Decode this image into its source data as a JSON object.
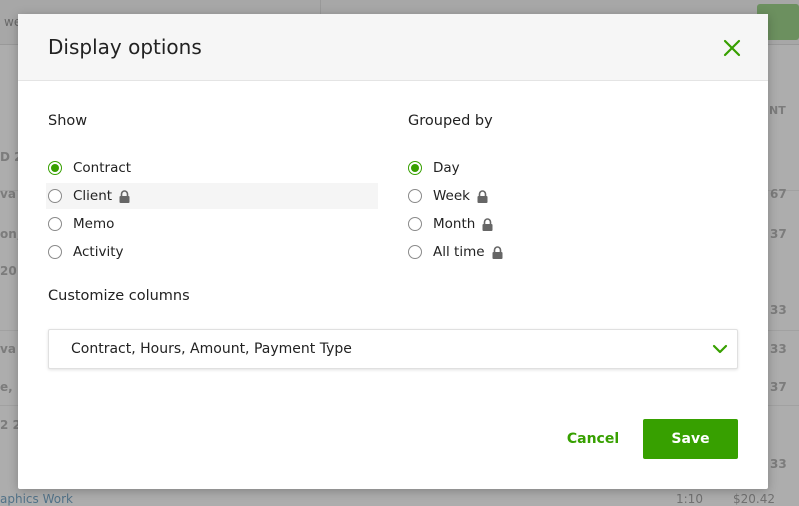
{
  "background": {
    "search_fragment": "we",
    "column_header_fragment": "NT",
    "row_fragments": [
      "D 2",
      "va",
      "on,",
      "20",
      "va",
      "e,",
      "2 2"
    ],
    "amount_fragments": [
      "67",
      "37",
      "33",
      "33",
      "37",
      "33"
    ],
    "bottom_row": {
      "label": "aphics Work",
      "hours": "1:10",
      "amount": "$20.42"
    }
  },
  "modal": {
    "title": "Display options",
    "close_icon": "close-icon",
    "show": {
      "title": "Show",
      "options": [
        {
          "label": "Contract",
          "checked": true,
          "locked": false
        },
        {
          "label": "Client",
          "checked": false,
          "locked": true
        },
        {
          "label": "Memo",
          "checked": false,
          "locked": false
        },
        {
          "label": "Activity",
          "checked": false,
          "locked": false
        }
      ]
    },
    "grouped_by": {
      "title": "Grouped by",
      "options": [
        {
          "label": "Day",
          "checked": true,
          "locked": false
        },
        {
          "label": "Week",
          "checked": false,
          "locked": true
        },
        {
          "label": "Month",
          "checked": false,
          "locked": true
        },
        {
          "label": "All time",
          "checked": false,
          "locked": true
        }
      ]
    },
    "customize_columns": {
      "title": "Customize columns",
      "value": "Contract, Hours, Amount, Payment Type",
      "chevron_icon": "chevron-down-icon"
    },
    "buttons": {
      "cancel": "Cancel",
      "save": "Save"
    }
  },
  "colors": {
    "accent": "#37a000",
    "text": "#222222",
    "header_bg": "#f6f6f6"
  }
}
